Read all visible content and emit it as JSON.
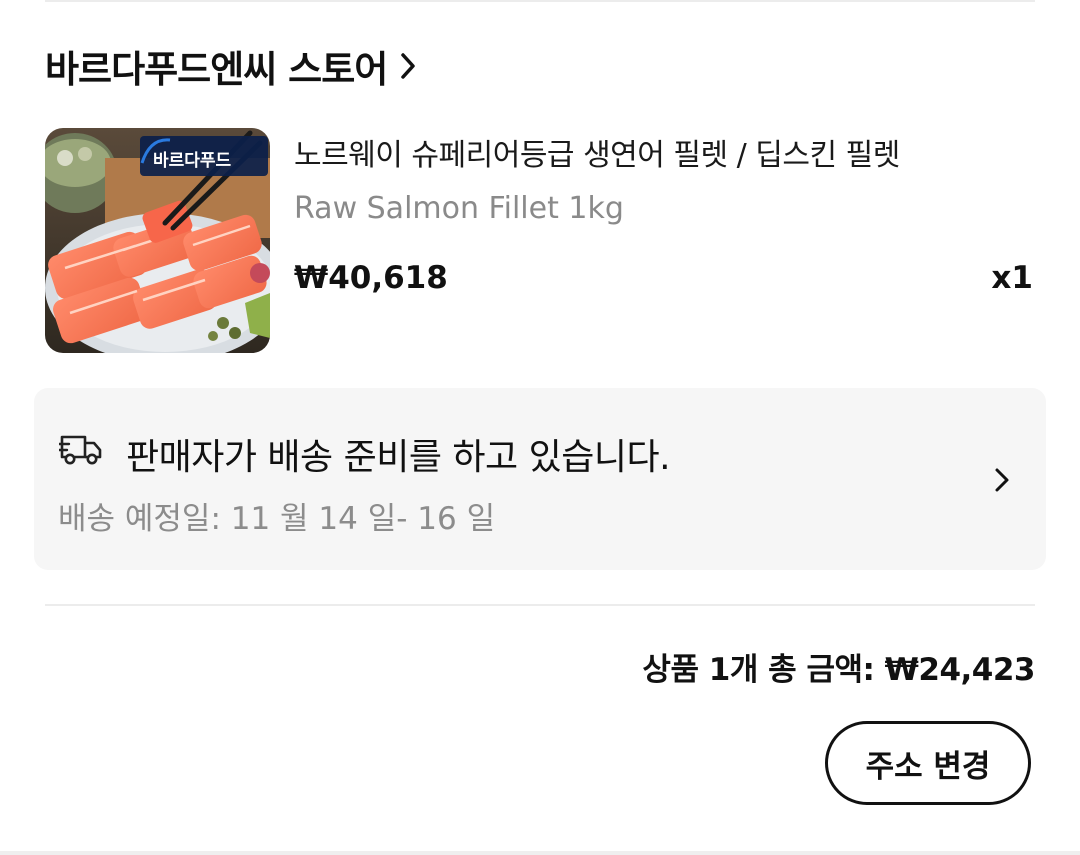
{
  "store": {
    "name": "바르다푸드엔씨 스토어",
    "chevron_icon": "chevron-right-icon"
  },
  "product": {
    "title": "노르웨이 슈페리어등급 생연어 필렛 / 딥스킨 필렛",
    "subtitle": "Raw Salmon Fillet 1kg",
    "price": "₩40,618",
    "quantity": "x1",
    "thumbnail_brand_text": "바르다푸드"
  },
  "shipping": {
    "icon": "delivery-truck-icon",
    "status": "판매자가 배송 준비를 하고 있습니다.",
    "eta": "배송 예정일: 11 월 14 일- 16 일",
    "chevron_icon": "chevron-right-icon"
  },
  "summary": {
    "total": "상품 1개 총 금액: ₩24,423"
  },
  "actions": {
    "change_address_label": "주소 변경"
  }
}
